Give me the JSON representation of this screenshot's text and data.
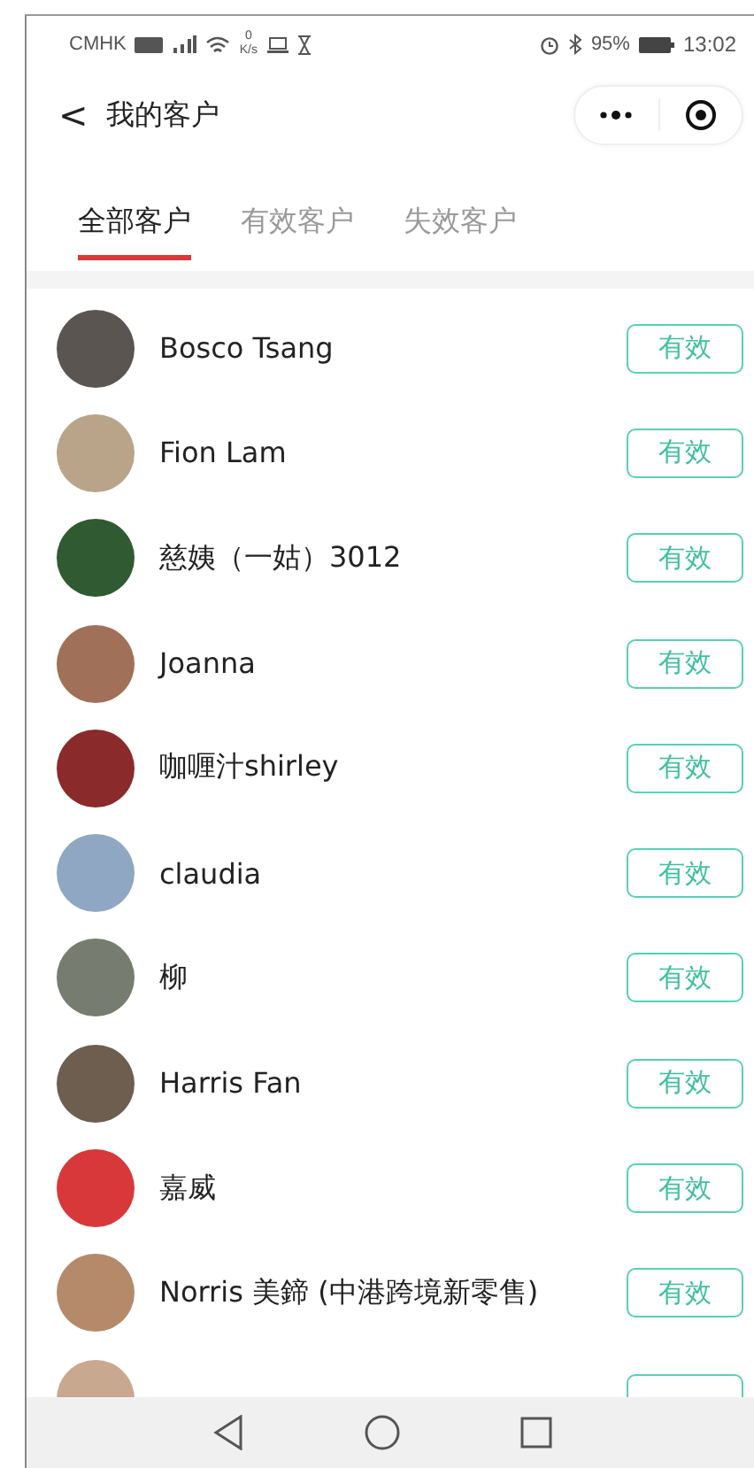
{
  "status_bar": {
    "carrier": "CMHK",
    "speed_value": "0",
    "speed_unit": "K/s",
    "battery": "95%",
    "time": "13:02"
  },
  "header": {
    "back": "<",
    "title": "我的客户"
  },
  "tabs": [
    {
      "label": "全部客户",
      "selected": true
    },
    {
      "label": "有效客户",
      "selected": false
    },
    {
      "label": "失效客户",
      "selected": false
    }
  ],
  "customers": [
    {
      "name": "Bosco Tsang",
      "status": "有效",
      "valid": true,
      "color": "#5a5550"
    },
    {
      "name": "Fion Lam",
      "status": "有效",
      "valid": true,
      "color": "#b9a48a"
    },
    {
      "name": "慈姨（一姑）3012",
      "status": "有效",
      "valid": true,
      "color": "#2f5a32"
    },
    {
      "name": "Joanna",
      "status": "有效",
      "valid": true,
      "color": "#a07058"
    },
    {
      "name": "咖喱汁shirley",
      "status": "有效",
      "valid": true,
      "color": "#8a2a2a"
    },
    {
      "name": "claudia",
      "status": "有效",
      "valid": true,
      "color": "#8fa7c2"
    },
    {
      "name": "柳",
      "status": "有效",
      "valid": true,
      "color": "#777c70"
    },
    {
      "name": "Harris Fan",
      "status": "有效",
      "valid": true,
      "color": "#6e5e50"
    },
    {
      "name": "嘉威",
      "status": "有效",
      "valid": true,
      "color": "#d8383a"
    },
    {
      "name": "Norris 美鍗 (中港跨境新零售)",
      "status": "有效",
      "valid": true,
      "color": "#b48a6a"
    },
    {
      "valid": true,
      "color": "#c9a890"
    }
  ]
}
